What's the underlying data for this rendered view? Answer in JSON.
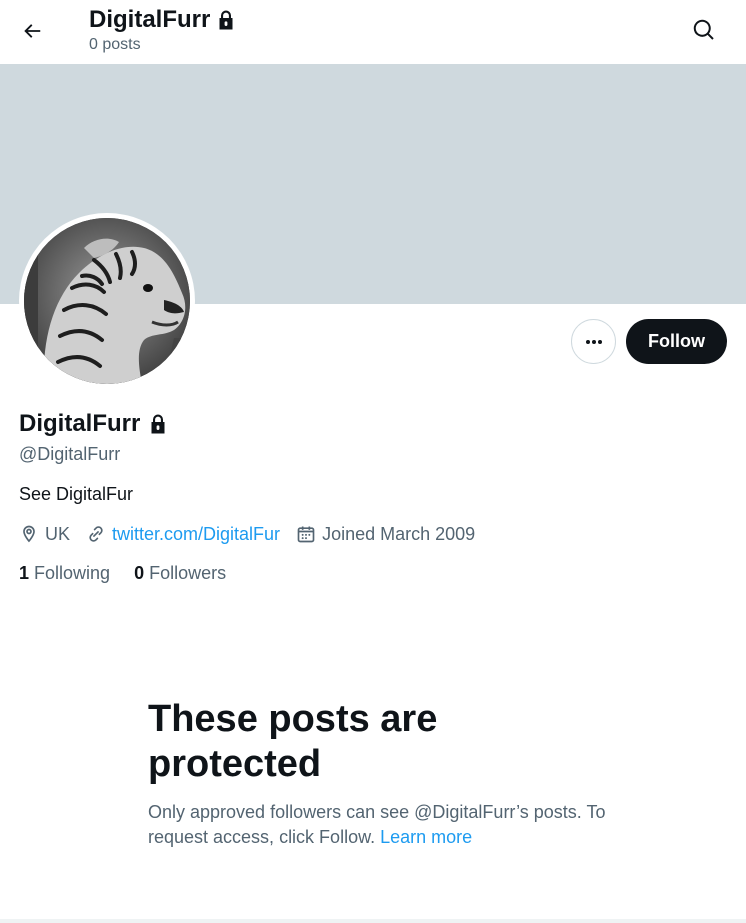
{
  "header": {
    "back_icon": "arrow-left-icon",
    "title": "DigitalFurr",
    "posts_count": "0 posts",
    "search_icon": "search-icon"
  },
  "colors": {
    "banner": "#cfd9de",
    "follow_bg": "#0f1419",
    "link": "#1d9bf0",
    "secondary_text": "#536471"
  },
  "profile": {
    "avatar": "tiger-avatar",
    "name": "DigitalFurr",
    "lock_icon": "lock-icon",
    "handle": "@DigitalFurr",
    "bio": "See DigitalFur",
    "location": "UK",
    "website": "twitter.com/DigitalFur",
    "joined": "Joined March 2009",
    "following_count": "1",
    "following_label": "Following",
    "followers_count": "0",
    "followers_label": "Followers"
  },
  "actions": {
    "more_icon": "more-horizontal-icon",
    "follow_label": "Follow"
  },
  "protected": {
    "title": "These posts are protected",
    "body": "Only approved followers can see @DigitalFurr’s posts. To request access, click Follow.",
    "link": "Learn more"
  }
}
